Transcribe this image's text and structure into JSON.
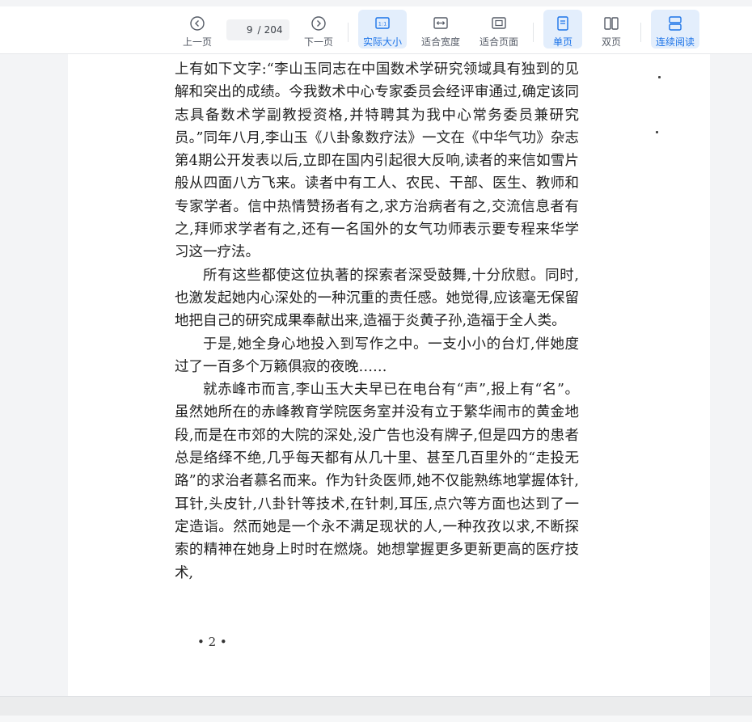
{
  "toolbar": {
    "prev_label": "上一页",
    "next_label": "下一页",
    "current_page": "9",
    "total_pages": "204",
    "actual_size_label": "实际大小",
    "fit_width_label": "适合宽度",
    "fit_page_label": "适合页面",
    "single_page_label": "单页",
    "double_page_label": "双页",
    "continuous_label": "连续阅读",
    "accent_color": "#1b73e8"
  },
  "document": {
    "paragraphs": [
      "上有如下文字:“李山玉同志在中国数术学研究领域具有独到的见解和突出的成绩。今我数术中心专家委员会经评审通过,确定该同志具备数术学副教授资格,并特聘其为我中心常务委员兼研究员。”同年八月,李山玉《八卦象数疗法》一文在《中华气功》杂志第4期公开发表以后,立即在国内引起很大反响,读者的来信如雪片般从四面八方飞来。读者中有工人、农民、干部、医生、教师和专家学者。信中热情赞扬者有之,求方治病者有之,交流信息者有之,拜师求学者有之,还有一名国外的女气功师表示要专程来华学习这一疗法。",
      "所有这些都使这位执著的探索者深受鼓舞,十分欣慰。同时,也激发起她内心深处的一种沉重的责任感。她觉得,应该毫无保留地把自己的研究成果奉献出来,造福于炎黄子孙,造福于全人类。",
      "于是,她全身心地投入到写作之中。一支小小的台灯,伴她度过了一百多个万籁俱寂的夜晚……",
      "就赤峰市而言,李山玉大夫早已在电台有“声”,报上有“名”。虽然她所在的赤峰教育学院医务室并没有立于繁华闹市的黄金地段,而是在市郊的大院的深处,没广告也没有牌子,但是四方的患者总是络绎不绝,几乎每天都有从几十里、甚至几百里外的“走投无路”的求治者慕名而来。作为针灸医师,她不仅能熟练地掌握体针,耳针,头皮针,八卦针等技术,在针刺,耳压,点穴等方面也达到了一定造诣。然而她是一个永不满足现状的人,一种孜孜以求,不断探索的精神在她身上时时在燃烧。她想掌握更多更新更高的医疗技术,"
    ],
    "page_number": "• 2 •"
  }
}
